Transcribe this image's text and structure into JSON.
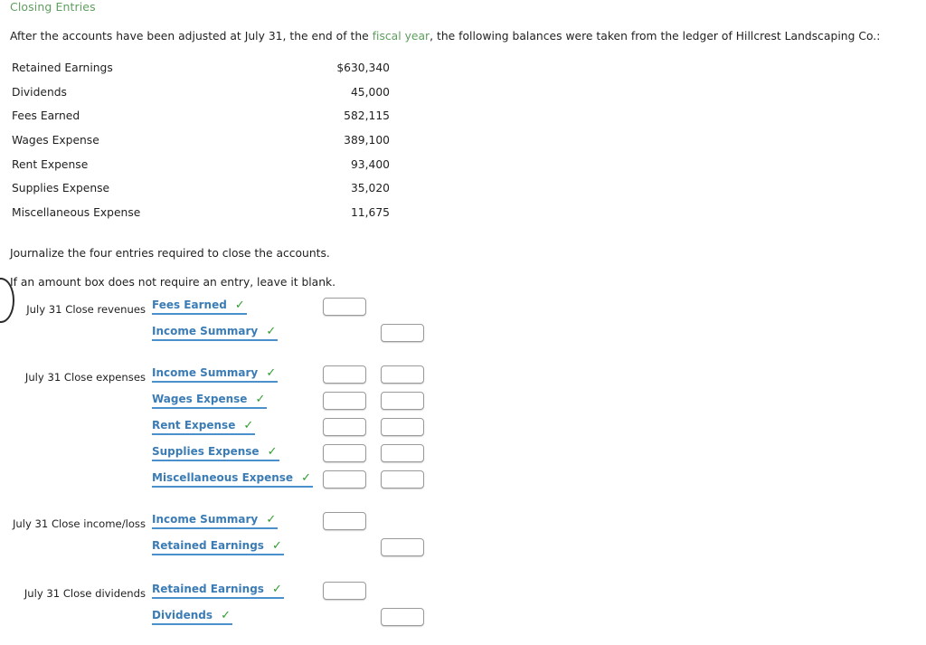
{
  "heading": "Closing Entries",
  "intro": {
    "before": "After the accounts have been adjusted at July 31, the end of the ",
    "link": "fiscal year",
    "after": ", the following balances were taken from the ledger of Hillcrest Landscaping Co.:"
  },
  "balances": {
    "rows": [
      {
        "account": "Retained Earnings",
        "amount": "$630,340"
      },
      {
        "account": "Dividends",
        "amount": "45,000"
      },
      {
        "account": "Fees Earned",
        "amount": "582,115"
      },
      {
        "account": "Wages Expense",
        "amount": "389,100"
      },
      {
        "account": "Rent Expense",
        "amount": "93,400"
      },
      {
        "account": "Supplies Expense",
        "amount": "35,020"
      },
      {
        "account": "Miscellaneous Expense",
        "amount": "11,675"
      }
    ]
  },
  "instructions": {
    "line1": "Journalize the four entries required to close the accounts.",
    "line2": "If an amount box does not require an entry, leave it blank."
  },
  "check_glyph": "✓",
  "colors": {
    "heading_green": "#5f9e5f",
    "link_blue": "#3b7cb5",
    "underline_blue": "#4a90cc",
    "check_green": "#2f9e2f",
    "box_border": "#9a9a9a"
  },
  "journal": {
    "entries": [
      {
        "label": "July 31 Close revenues",
        "lines": [
          {
            "account": "Fees Earned",
            "debit_value": "",
            "credit_value": "",
            "has_debit": true,
            "has_credit": false
          },
          {
            "account": "Income Summary",
            "debit_value": "",
            "credit_value": "",
            "has_debit": false,
            "has_credit": true
          }
        ]
      },
      {
        "label": "July 31 Close expenses",
        "lines": [
          {
            "account": "Income Summary",
            "debit_value": "",
            "credit_value": "",
            "has_debit": true,
            "has_credit": true
          },
          {
            "account": "Wages Expense",
            "debit_value": "",
            "credit_value": "",
            "has_debit": true,
            "has_credit": true
          },
          {
            "account": "Rent Expense",
            "debit_value": "",
            "credit_value": "",
            "has_debit": true,
            "has_credit": true
          },
          {
            "account": "Supplies Expense",
            "debit_value": "",
            "credit_value": "",
            "has_debit": true,
            "has_credit": true
          },
          {
            "account": "Miscellaneous Expense",
            "debit_value": "",
            "credit_value": "",
            "has_debit": true,
            "has_credit": true
          }
        ]
      },
      {
        "label": "July 31 Close income/loss",
        "lines": [
          {
            "account": "Income Summary",
            "debit_value": "",
            "credit_value": "",
            "has_debit": true,
            "has_credit": false
          },
          {
            "account": "Retained Earnings",
            "debit_value": "",
            "credit_value": "",
            "has_debit": false,
            "has_credit": true
          }
        ]
      },
      {
        "label": "July 31 Close dividends",
        "lines": [
          {
            "account": "Retained Earnings",
            "debit_value": "",
            "credit_value": "",
            "has_debit": true,
            "has_credit": false
          },
          {
            "account": "Dividends",
            "debit_value": "",
            "credit_value": "",
            "has_debit": false,
            "has_credit": true
          }
        ]
      }
    ]
  }
}
